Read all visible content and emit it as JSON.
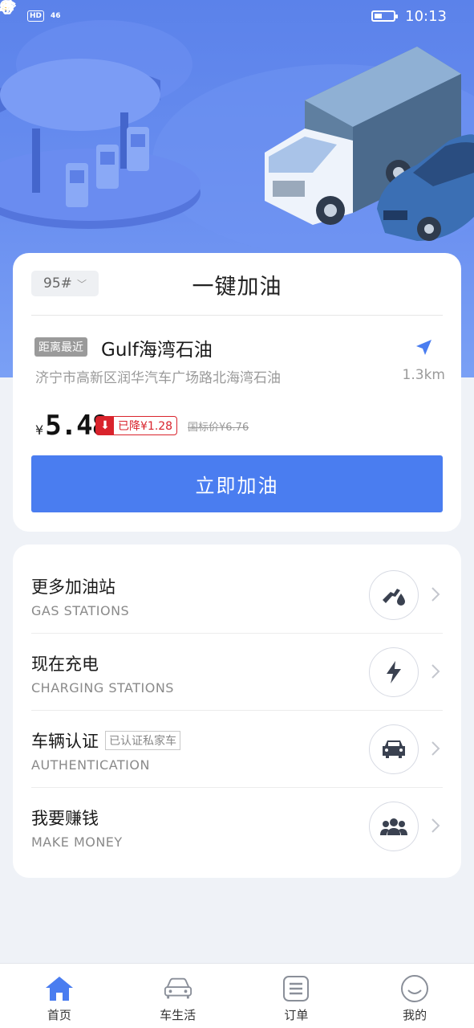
{
  "status_bar": {
    "hd_label": "HD",
    "signal_label": "46",
    "time": "10:13"
  },
  "fuel": {
    "grade": "95#",
    "title": "一键加油",
    "nearest_badge": "距离最近",
    "station_name": "Gulf海湾石油",
    "station_address": "济宁市高新区润华汽车广场路北海湾石油",
    "distance": "1.3km",
    "currency": "¥",
    "price": "5.48",
    "discount": "已降¥1.28",
    "list_price": "国标价¥6.76",
    "button_label": "立即加油"
  },
  "services": [
    {
      "title": "更多加油站",
      "subtitle": "GAS STATIONS",
      "icon": "fuel-nozzle-icon"
    },
    {
      "title": "现在充电",
      "subtitle": "CHARGING STATIONS",
      "icon": "lightning-icon"
    },
    {
      "title": "车辆认证",
      "tag": "已认证私家车",
      "subtitle": "AUTHENTICATION",
      "icon": "car-icon"
    },
    {
      "title": "我要赚钱",
      "subtitle": "MAKE MONEY",
      "icon": "people-icon"
    }
  ],
  "tabs": [
    {
      "label": "首页",
      "icon": "home-icon",
      "active": true
    },
    {
      "label": "车生活",
      "icon": "car-life-icon",
      "active": false
    },
    {
      "label": "订单",
      "icon": "orders-icon",
      "active": false
    },
    {
      "label": "我的",
      "icon": "profile-icon",
      "active": false
    }
  ],
  "colors": {
    "hero": "#5b82ea",
    "accent": "#4a7df0",
    "discount_red": "#d9232c",
    "background": "#eff2f7"
  }
}
